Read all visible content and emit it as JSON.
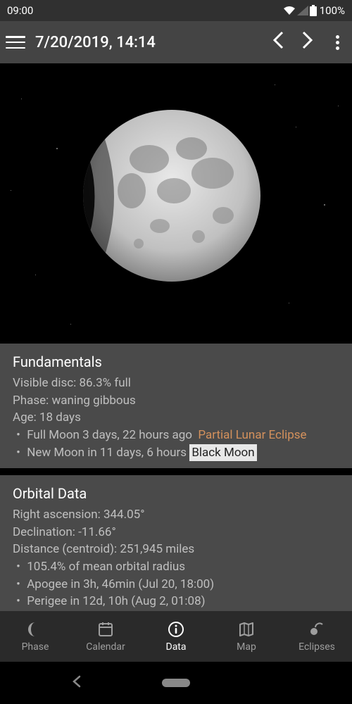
{
  "status": {
    "time": "09:00",
    "battery": "100%"
  },
  "header": {
    "datetime": "7/20/2019, 14:14"
  },
  "fundamentals": {
    "title": "Fundamentals",
    "visible_disc": "Visible disc: 86.3% full",
    "phase": "Phase: waning gibbous",
    "age": "Age: 18 days",
    "full_moon": "Full Moon 3 days, 22 hours ago",
    "full_moon_event": "Partial Lunar Eclipse",
    "new_moon": "New Moon in 11 days, 6 hours",
    "new_moon_tag": "Black Moon"
  },
  "orbital": {
    "title": "Orbital Data",
    "ra": "Right ascension: 344.05°",
    "dec": "Declination: -11.66°",
    "distance": "Distance (centroid): 251,945 miles",
    "radius_pct": "105.4% of mean orbital radius",
    "apogee": "Apogee in 3h, 46min (Jul 20, 18:00)",
    "perigee": "Perigee in 12d, 10h (Aug 2, 01:08)"
  },
  "nav": {
    "phase": "Phase",
    "calendar": "Calendar",
    "data": "Data",
    "map": "Map",
    "eclipses": "Eclipses"
  }
}
